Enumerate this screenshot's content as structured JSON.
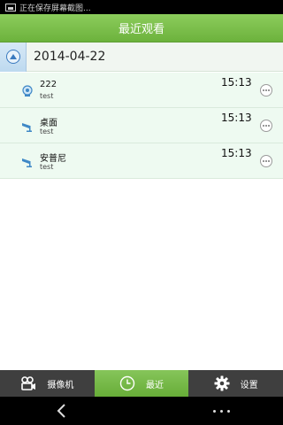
{
  "status_bar": {
    "notification_text": "正在保存屏幕截图..."
  },
  "header": {
    "title": "最近观看"
  },
  "group": {
    "date": "2014-04-22"
  },
  "items": [
    {
      "name": "222",
      "subtitle": "test",
      "time": "15:13",
      "icon": "device-icon"
    },
    {
      "name": "桌面",
      "subtitle": "test",
      "time": "15:13",
      "icon": "camera-icon"
    },
    {
      "name": "安普尼",
      "subtitle": "test",
      "time": "15:13",
      "icon": "camera-icon"
    }
  ],
  "tabs": [
    {
      "label": "摄像机",
      "icon": "camcorder-icon",
      "active": false
    },
    {
      "label": "最近",
      "icon": "clock-icon",
      "active": true
    },
    {
      "label": "设置",
      "icon": "gear-icon",
      "active": false
    }
  ],
  "colors": {
    "accent": "#6cb23c",
    "list_bg": "#eefaf1",
    "tabbar_bg": "#3f3f3f"
  }
}
